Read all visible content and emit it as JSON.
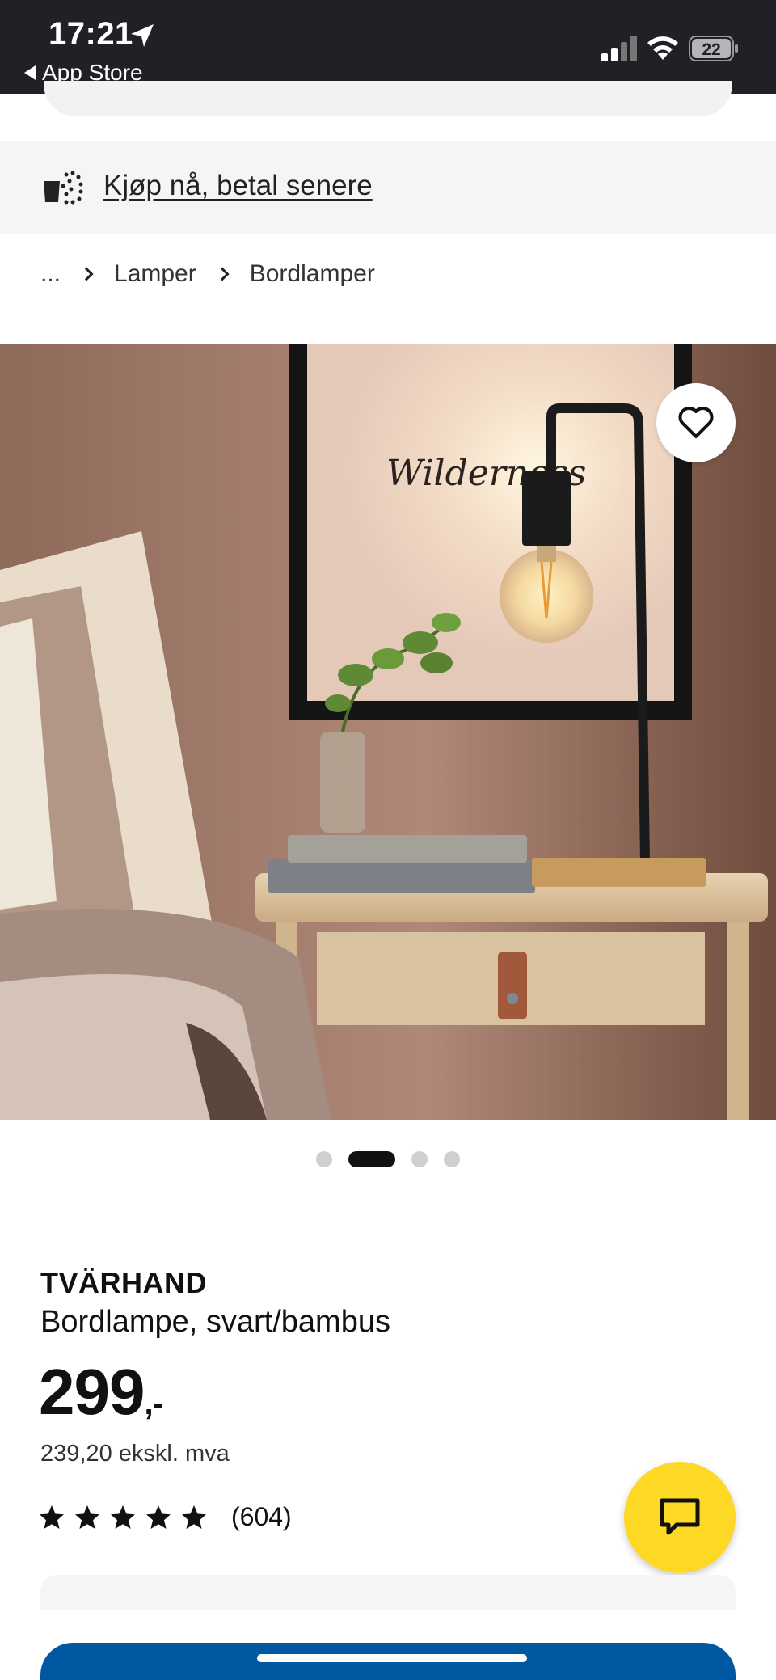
{
  "status_bar": {
    "time": "17:21",
    "back_label": "App Store",
    "battery": "22"
  },
  "banner": {
    "pay_later_label": "Kjøp nå, betal senere"
  },
  "breadcrumb": {
    "items": [
      "...",
      "Lamper",
      "Bordlamper"
    ]
  },
  "hero": {
    "poster_text": "Wilderness",
    "carousel": {
      "count": 4,
      "active_index": 1
    }
  },
  "product": {
    "name": "TVÄRHAND",
    "description": "Bordlampe, svart/bambus",
    "price": "299",
    "price_suffix": ",-",
    "price_ex_vat": "239,20 ekskl. mva",
    "rating": 5,
    "review_count": "(604)"
  },
  "colors": {
    "accent_yellow": "#fdd925",
    "brand_blue": "#0058a3",
    "status_bar": "#1f2126"
  },
  "icons": [
    "location-arrow-icon",
    "signal-icon",
    "wifi-icon",
    "battery-icon",
    "pay-later-icon",
    "chevron-right-icon",
    "heart-icon",
    "star-icon",
    "chat-icon"
  ]
}
